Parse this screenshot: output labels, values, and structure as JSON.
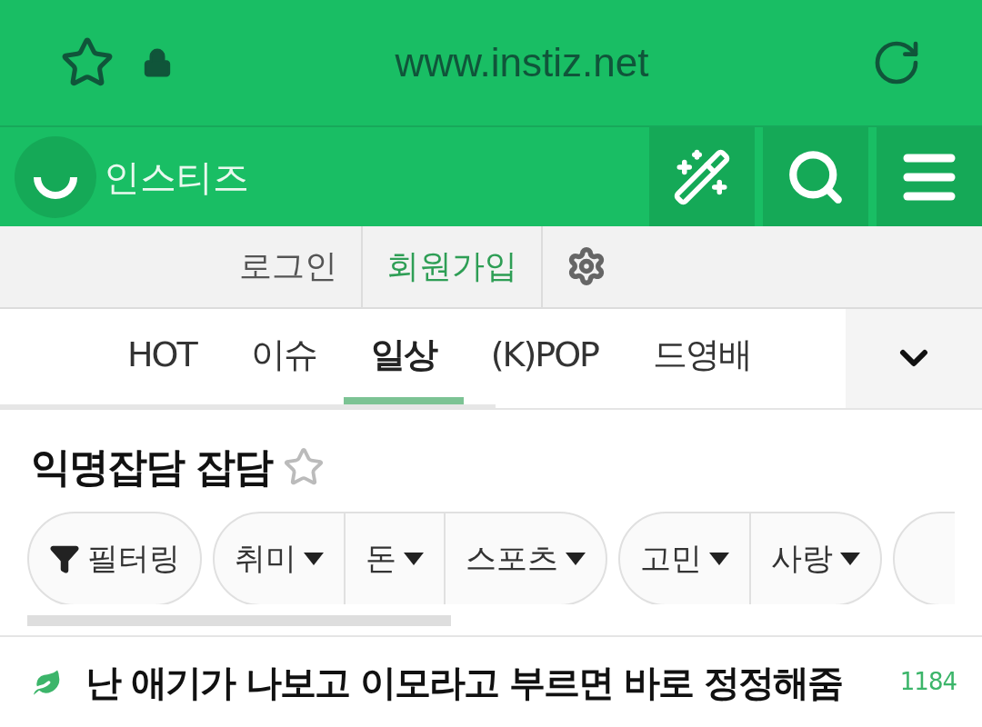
{
  "address_bar": {
    "url": "www.instiz.net"
  },
  "header": {
    "logo": "인스티즈"
  },
  "account_bar": {
    "links": [
      "로그인",
      "회원가입"
    ]
  },
  "tabs": [
    {
      "label": "HOT",
      "selected": false
    },
    {
      "label": "이슈",
      "selected": false
    },
    {
      "label": "일상",
      "selected": true
    },
    {
      "label": "(K)POP",
      "selected": false
    },
    {
      "label": "드영배",
      "selected": false
    }
  ],
  "board": {
    "title": "익명잡담 잡담",
    "favorite": false
  },
  "filters": {
    "groups": [
      [
        {
          "label": "필터링",
          "kind": "filter"
        }
      ],
      [
        {
          "label": "취미",
          "kind": "dropdown"
        },
        {
          "label": "돈",
          "kind": "dropdown"
        },
        {
          "label": "스포츠",
          "kind": "dropdown"
        }
      ],
      [
        {
          "label": "고민",
          "kind": "dropdown"
        },
        {
          "label": "사랑",
          "kind": "dropdown"
        }
      ]
    ]
  },
  "posts": [
    {
      "title": "난 애기가 나보고 이모라고 부르면 바로 정정해줌",
      "count": "1184"
    }
  ]
}
